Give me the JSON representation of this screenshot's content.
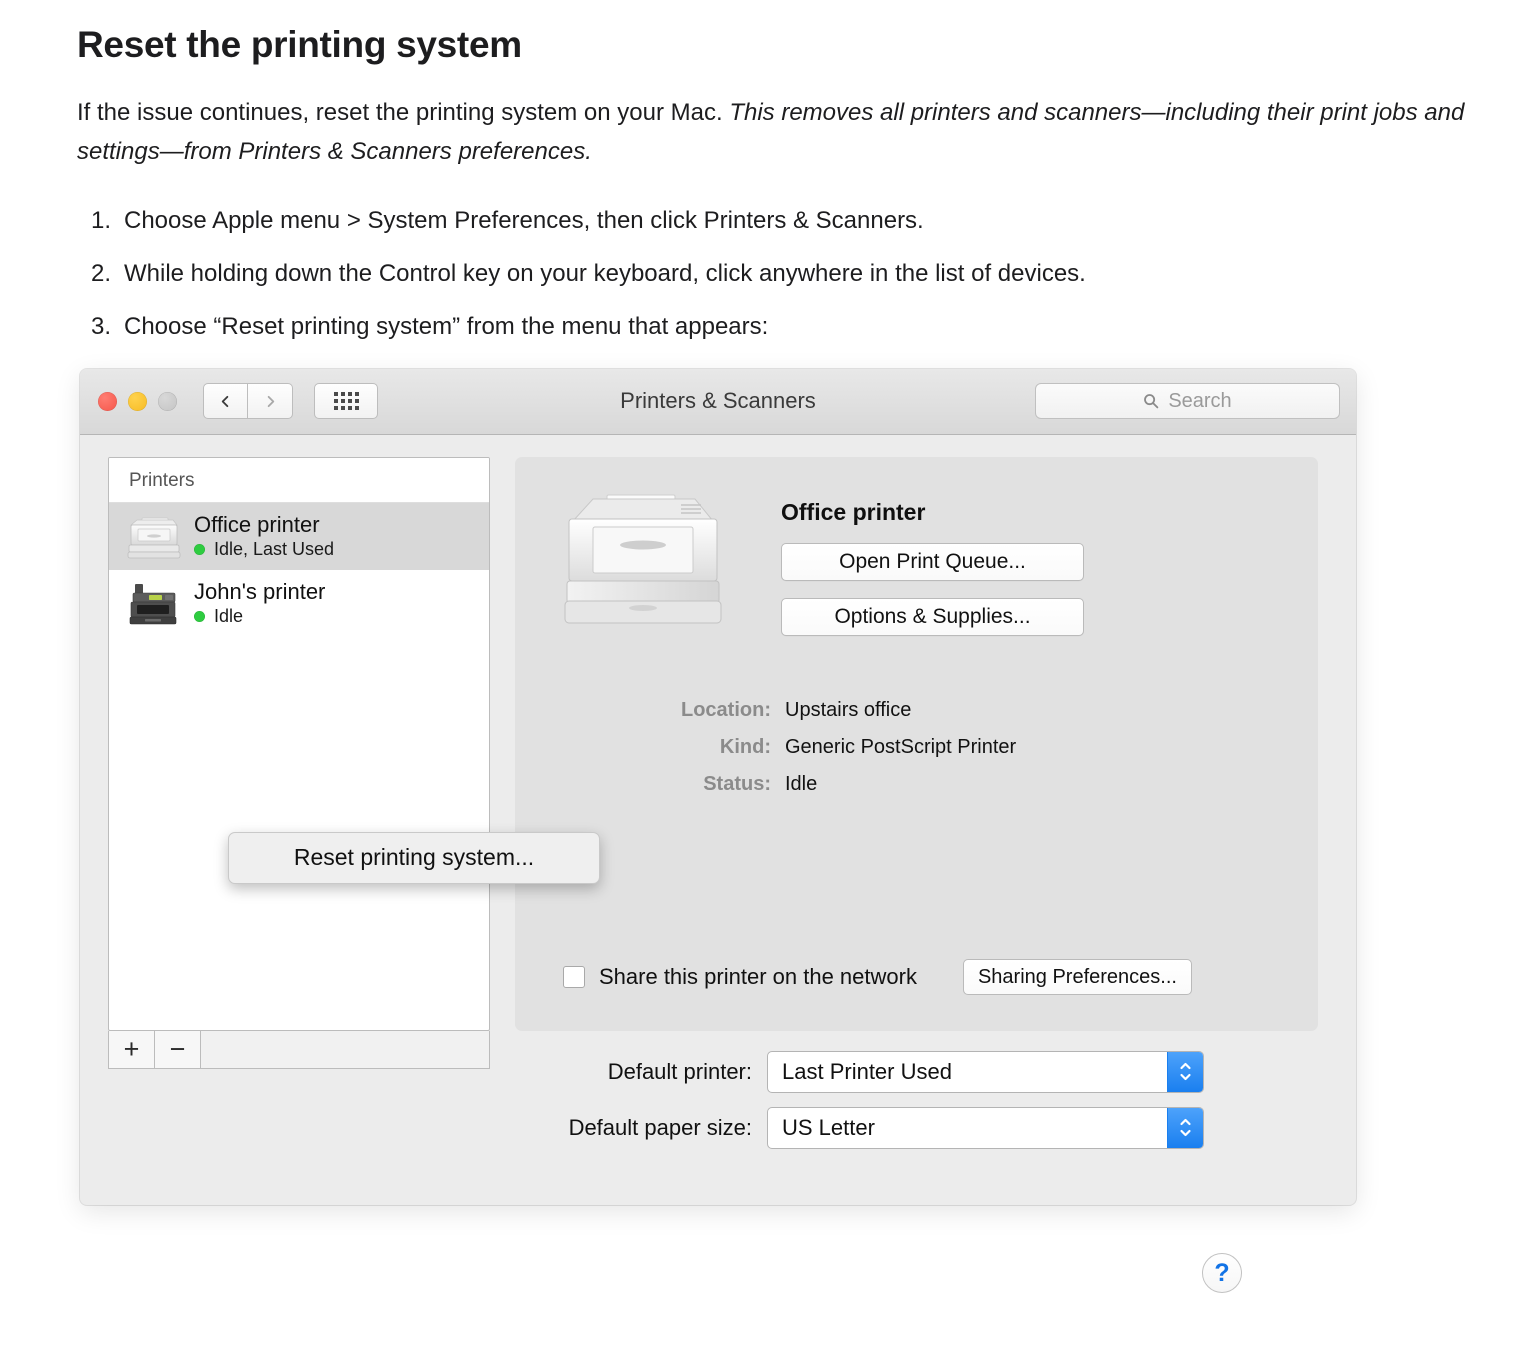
{
  "article": {
    "title": "Reset the printing system",
    "intro_plain": "If the issue continues, reset the printing system on your Mac. ",
    "intro_italic": "This removes all printers and scanners—including their print jobs and settings—from Printers & Scanners preferences.",
    "steps": [
      "Choose Apple menu > System Preferences, then click Printers & Scanners.",
      "While holding down the Control key on your keyboard, click anywhere in the list of devices.",
      "Choose “Reset printing system” from the menu that appears:"
    ]
  },
  "window": {
    "title": "Printers & Scanners",
    "traffic_lights": [
      "close",
      "minimize",
      "zoom"
    ],
    "back_icon": "chevron-left-icon",
    "forward_icon": "chevron-right-icon",
    "grid_icon": "show-all-grid-icon",
    "search": {
      "icon": "search-icon",
      "placeholder": "Search",
      "value": ""
    }
  },
  "sidebar": {
    "header": "Printers",
    "printers": [
      {
        "name": "Office printer",
        "status": "Idle, Last Used",
        "selected": true,
        "icon": "laser-printer-icon",
        "status_color": "#2ecc40"
      },
      {
        "name": "John's printer",
        "status": "Idle",
        "selected": false,
        "icon": "multifunction-printer-icon",
        "status_color": "#2ecc40"
      }
    ],
    "add_label": "+",
    "remove_label": "−"
  },
  "context_menu": {
    "items": [
      "Reset printing system..."
    ]
  },
  "detail": {
    "device_name": "Office printer",
    "printer_icon": "laser-printer-large-icon",
    "buttons": [
      "Open Print Queue...",
      "Options & Supplies..."
    ],
    "info": [
      {
        "label": "Location:",
        "value": "Upstairs office"
      },
      {
        "label": "Kind:",
        "value": "Generic PostScript Printer"
      },
      {
        "label": "Status:",
        "value": "Idle"
      }
    ],
    "share": {
      "checkbox_checked": false,
      "label": "Share this printer on the network",
      "button": "Sharing Preferences..."
    }
  },
  "footer": {
    "rows": [
      {
        "label": "Default printer:",
        "value": "Last Printer Used"
      },
      {
        "label": "Default paper size:",
        "value": "US Letter"
      }
    ],
    "help_label": "?",
    "help_icon": "help-question-icon"
  },
  "colors": {
    "accent_blue": "#1a7fef",
    "status_green": "#2ecc40",
    "help_blue": "#1273e6",
    "window_bg": "#ececec",
    "panel_bg": "#e1e1e1"
  }
}
